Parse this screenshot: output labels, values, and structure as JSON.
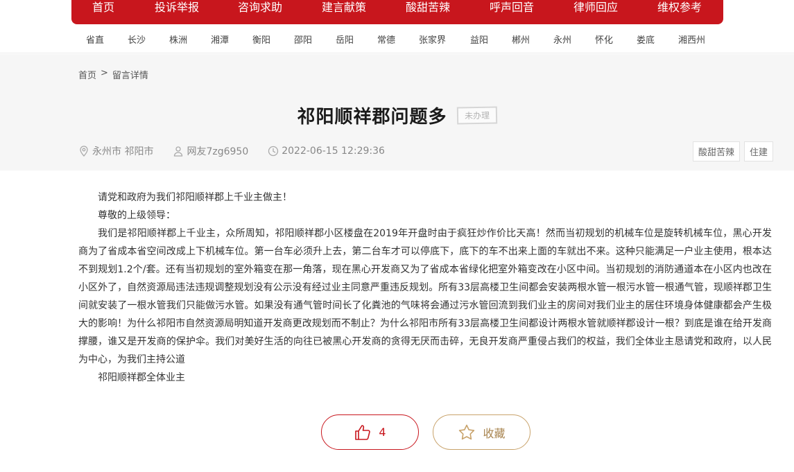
{
  "topnav": {
    "items": [
      "首页",
      "投诉举报",
      "咨询求助",
      "建言献策",
      "酸甜苦辣",
      "呼声回音",
      "律师回应",
      "维权参考"
    ]
  },
  "cities": [
    "省直",
    "长沙",
    "株洲",
    "湘潭",
    "衡阳",
    "邵阳",
    "岳阳",
    "常德",
    "张家界",
    "益阳",
    "郴州",
    "永州",
    "怀化",
    "娄底",
    "湘西州"
  ],
  "breadcrumb": {
    "home": "首页",
    "separator": ">",
    "current": "留言详情"
  },
  "post": {
    "title": "祁阳顺祥郡问题多",
    "status": "未办理",
    "location": "永州市 祁阳市",
    "author": "网友7zg6950",
    "datetime": "2022-06-15 12:29:36",
    "tags": [
      "酸甜苦辣",
      "住建"
    ],
    "paragraphs": [
      "请党和政府为我们祁阳顺祥郡上千业主做主！",
      "尊敬的上级领导：",
      "我们是祁阳顺祥郡上千业主，众所周知，祁阳顺祥郡小区楼盘在2019年开盘时由于疯狂炒作价比天高！然而当初规划的机械车位是旋转机械车位，黑心开发商为了省成本省空间改成上下机械车位。第一台车必须升上去，第二台车才可以停底下，底下的车不出来上面的车就出不来。这种只能满足一户业主使用，根本达不到规划1.2个/套。还有当初规划的室外箱变在那一角落，现在黑心开发商又为了省成本省绿化把室外箱变改在小区中间。当初规划的消防通道本在小区内也改在小区外了，自然资源局违法违规调整规划没有公示没有经过业主同意严重违反规划。所有33层高楼卫生间都会安装两根水管一根污水管一根通气管，现顺祥郡卫生间就安装了一根水管我们只能做污水管。如果没有通气管时间长了化粪池的气味将会通过污水管回流到我们业主的房间对我们业主的居住环境身体健康都会产生极大的影响！为什么祁阳市自然资源局明知道开发商更改规划而不制止？为什么祁阳市所有33层高楼卫生间都设计两根水管就顺祥郡设计一根？到底是谁在给开发商撑腰，谁又是开发商的保护伞。我们对美好生活的向往已被黑心开发商的贪得无厌而击碎，无良开发商严重侵占我们的权益，我们全体业主恳请党和政府，以人民为中心，为我们主持公道",
      "祁阳顺祥郡全体业主"
    ]
  },
  "actions": {
    "like_count": "4",
    "favorite_label": "收藏"
  },
  "colors": {
    "brand_red": "#c8161d",
    "gold": "#c8a26a"
  },
  "icons": [
    "location-icon",
    "user-icon",
    "clock-icon",
    "thumbs-up-icon",
    "star-icon"
  ]
}
